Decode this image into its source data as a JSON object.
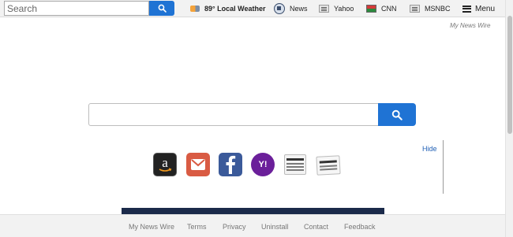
{
  "toolbar": {
    "search_placeholder": "Search",
    "weather_label": "89° Local Weather",
    "news_label": "News",
    "yahoo_label": "Yahoo",
    "cnn_label": "CNN",
    "msnbc_label": "MSNBC",
    "menu_label": "Menu"
  },
  "brand": "My News Wire",
  "main_search": {
    "value": "",
    "button_icon": "search-icon"
  },
  "tiles": [
    {
      "name": "amazon",
      "icon": "amazon-icon"
    },
    {
      "name": "gmail",
      "icon": "mail-icon"
    },
    {
      "name": "facebook",
      "icon": "facebook-icon"
    },
    {
      "name": "yahoo",
      "icon": "yahoo-icon",
      "glyph": "Y!"
    },
    {
      "name": "news",
      "icon": "newspaper-icon"
    },
    {
      "name": "news-2",
      "icon": "newspaper-icon"
    }
  ],
  "hide_label": "Hide",
  "footer": {
    "links": [
      "My News Wire",
      "Terms",
      "Privacy",
      "Uninstall",
      "Contact",
      "Feedback"
    ]
  },
  "colors": {
    "accent": "#1f73d4",
    "link": "#1f5fb5",
    "toolbar_bg": "#f2f2f2",
    "footer_bg": "#f2f2f2"
  }
}
